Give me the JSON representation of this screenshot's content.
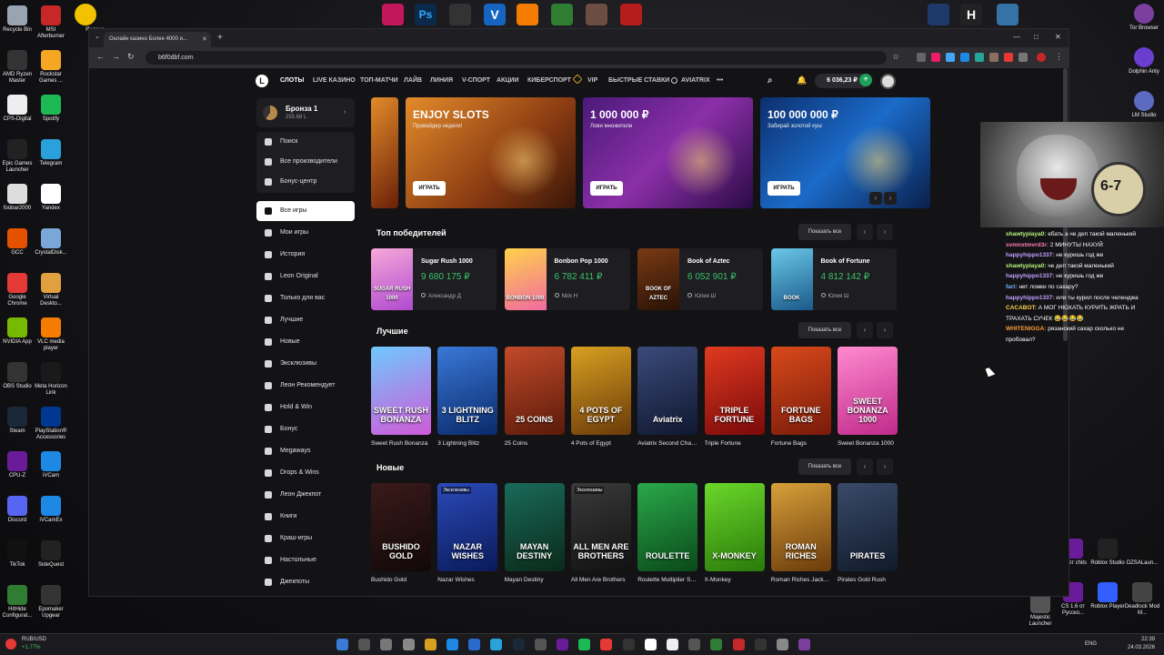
{
  "desktop": {
    "left_icons": [
      {
        "label": "Recycle Bin",
        "color": "#9aa4b1"
      },
      {
        "label": "MSI Afterburner",
        "color": "#c62828"
      },
      {
        "label": "AMD Ryzen Master",
        "color": "#333"
      },
      {
        "label": "Rockstar Games ...",
        "color": "#f5a623"
      },
      {
        "label": "CPS-Digital",
        "color": "#eee"
      },
      {
        "label": "Spotify",
        "color": "#1db954"
      },
      {
        "label": "Epic Games Launcher",
        "color": "#222"
      },
      {
        "label": "Telegram",
        "color": "#2aa1da"
      },
      {
        "label": "foobar2000",
        "color": "#ddd"
      },
      {
        "label": "Yandex",
        "color": "#fff"
      },
      {
        "label": "GCC",
        "color": "#e65100"
      },
      {
        "label": "CrystalDisk...",
        "color": "#7aa7d8"
      },
      {
        "label": "Google Chrome",
        "color": "#e53935"
      },
      {
        "label": "Virtual Deskto...",
        "color": "#e0a040"
      },
      {
        "label": "NVIDIA App",
        "color": "#76b900"
      },
      {
        "label": "VLC media player",
        "color": "#f57c00"
      },
      {
        "label": "OBS Studio",
        "color": "#333"
      },
      {
        "label": "Meta Horizon Link",
        "color": "#1a1a1a"
      },
      {
        "label": "Steam",
        "color": "#1b2838"
      },
      {
        "label": "PlayStation® Accessories",
        "color": "#003791"
      },
      {
        "label": "CPU-Z",
        "color": "#6a1b9a"
      },
      {
        "label": "iVCam",
        "color": "#1e88e5"
      },
      {
        "label": "Discord",
        "color": "#5865f2"
      },
      {
        "label": "iVCamEx",
        "color": "#1e88e5"
      },
      {
        "label": "TikTok",
        "color": "#111"
      },
      {
        "label": "SideQuest",
        "color": "#222"
      },
      {
        "label": "HitHide Configurat...",
        "color": "#2e7d32"
      },
      {
        "label": "Epomaker Upgear",
        "color": "#333"
      }
    ],
    "top_extra_label": "Яндекс",
    "right_icons": [
      {
        "label": "Tor Browser",
        "color": "#7b3fa0"
      },
      {
        "label": "Dolphin Anty",
        "color": "#6a3fd0"
      },
      {
        "label": "LM Studio",
        "color": "#5c6bc0"
      }
    ],
    "right_bottom_icons": [
      {
        "label": "Roblox Studio",
        "color": "#222"
      },
      {
        "label": "DZSALaun...",
        "color": "#111"
      },
      {
        "label": "Roblox Player",
        "color": "#335fff"
      },
      {
        "label": "Deadlock Mod M...",
        "color": "#444"
      },
      {
        "label": "Majestic Launcher",
        "color": "#555"
      },
      {
        "label": "CS 1.6 от Русско...",
        "color": "#6a1b9a"
      },
      {
        "label": "1.6 от chits",
        "color": "#6a1b9a"
      }
    ]
  },
  "browser": {
    "tab_title": "Онлайн казино Более 4000 и...",
    "url": "b6f0dbf.com",
    "win_controls": [
      "—",
      "□",
      "✕"
    ]
  },
  "site": {
    "logo": "L",
    "nav": [
      "СЛОТЫ",
      "LIVE КАЗИНО",
      "ТОП-МАТЧИ",
      "ЛАЙВ",
      "ЛИНИЯ",
      "V-СПОРТ",
      "АКЦИИ",
      "КИБЕРСПОРТ",
      "VIP",
      "БЫСТРЫЕ СТАВКИ",
      "AVIATRIX",
      "•••"
    ],
    "balance": "6 036,23 ₽",
    "profile": {
      "name": "Бронза 1",
      "points": "255.68 L"
    },
    "sidebar_top": [
      "Поиск",
      "Все производители",
      "Бонус-центр"
    ],
    "sidebar_items": [
      "Все игры",
      "Мои игры",
      "История",
      "Leon Original",
      "Только для вас",
      "Лучшие",
      "Новые",
      "Эксклюзивы",
      "Леон Рекомендует",
      "Hold & Win",
      "Бонус",
      "Megaways",
      "Drops & Wins",
      "Леон Джекпот",
      "Книги",
      "Краш-игры",
      "Настольные",
      "Джекпоты"
    ],
    "banners": [
      {
        "title": "ENJOY SLOTS",
        "subtitle": "Провайдер недели!",
        "button": "ИГРАТЬ",
        "bg": "linear-gradient(135deg,#e38b2a,#8a3b12 60%,#3a1608)"
      },
      {
        "title": "1 000 000 ₽",
        "subtitle": "Лови множители",
        "button": "ИГРАТЬ",
        "bg": "linear-gradient(135deg,#4a1a7a,#8b2fa8 50%,#2a0b45)"
      },
      {
        "title": "100 000 000 ₽",
        "subtitle": "Забирай золотой куш",
        "button": "ИГРАТЬ",
        "bg": "linear-gradient(135deg,#0d2f6e,#1b6bc9 50%,#0a1f4a)"
      }
    ],
    "sections": {
      "winners_title": "Топ победителей",
      "best_title": "Лучшие",
      "new_title": "Новые",
      "show_all": "Показать все"
    },
    "winners": [
      {
        "game": "Sugar Rush 1000",
        "amount": "9 680 175 ₽",
        "user": "Александр Д",
        "thumb": "linear-gradient(160deg,#f7a8d8,#b04ad0)",
        "art": "SUGAR RUSH 1000"
      },
      {
        "game": "Bonbon Pop 1000",
        "amount": "6 782 411 ₽",
        "user": "Nick H",
        "thumb": "linear-gradient(160deg,#ffd24a,#f06aa0)",
        "art": "BONBON 1000"
      },
      {
        "game": "Book of Aztec",
        "amount": "6 052 901 ₽",
        "user": "Юлия Ш",
        "thumb": "linear-gradient(160deg,#7a3a14,#2a1206)",
        "art": "BOOK OF AZTEC"
      },
      {
        "game": "Book of Fortune",
        "amount": "4 812 142 ₽",
        "user": "Юлия Ш",
        "thumb": "linear-gradient(160deg,#6ac8e8,#1a5a8a)",
        "art": "BOOK"
      }
    ],
    "best_games": [
      {
        "name": "Sweet Rush Bonanza",
        "bg": "linear-gradient(160deg,#6fc8ff,#d05ad8)",
        "art": "SWEET RUSH BONANZA"
      },
      {
        "name": "3 Lightning Blitz",
        "bg": "linear-gradient(160deg,#3a78d8,#0a2a6a)",
        "art": "3 LIGHTNING BLITZ"
      },
      {
        "name": "25 Coins",
        "bg": "linear-gradient(160deg,#c24a2a,#5a1a0a)",
        "art": "25 COINS"
      },
      {
        "name": "4 Pots of Egypt",
        "bg": "linear-gradient(160deg,#d8a020,#6a3a0a)",
        "art": "4 POTS OF EGYPT"
      },
      {
        "name": "Aviatrix Second Chance",
        "bg": "linear-gradient(160deg,#3a4a7a,#101830)",
        "art": "Aviatrix"
      },
      {
        "name": "Triple Fortune",
        "bg": "linear-gradient(160deg,#e03a20,#7a0a0a)",
        "art": "TRIPLE FORTUNE"
      },
      {
        "name": "Fortune Bags",
        "bg": "linear-gradient(160deg,#d84a1a,#7a1a0a)",
        "art": "FORTUNE BAGS"
      },
      {
        "name": "Sweet Bonanza 1000",
        "bg": "linear-gradient(160deg,#ff8ad0,#c02a8a)",
        "art": "SWEET BONANZA 1000"
      }
    ],
    "new_games": [
      {
        "name": "Bushido Gold",
        "bg": "linear-gradient(160deg,#3a1a1a,#120808)",
        "art": "BUSHIDO GOLD",
        "tag": ""
      },
      {
        "name": "Nazar Wishes",
        "bg": "linear-gradient(160deg,#2a4ab8,#0a1a5a)",
        "art": "NAZAR WISHES",
        "tag": "Эксклюзивы"
      },
      {
        "name": "Mayan Destiny",
        "bg": "linear-gradient(160deg,#1a6a5a,#0a2a1a)",
        "art": "MAYAN DESTINY",
        "tag": ""
      },
      {
        "name": "All Men Are Brothers",
        "bg": "linear-gradient(160deg,#3a3a3a,#111)",
        "art": "ALL MEN ARE BROTHERS",
        "tag": "Эксклюзивы"
      },
      {
        "name": "Roulette Multiplier Spin",
        "bg": "linear-gradient(160deg,#2aa84a,#0a4a1a)",
        "art": "ROULETTE",
        "tag": ""
      },
      {
        "name": "X-Monkey",
        "bg": "linear-gradient(160deg,#6ad82a,#2a7a0a)",
        "art": "X-MONKEY",
        "tag": ""
      },
      {
        "name": "Roman Riches Jackpot",
        "bg": "linear-gradient(160deg,#d8a03a,#6a3a0a)",
        "art": "ROMAN RICHES",
        "tag": ""
      },
      {
        "name": "Pirates Gold Rush",
        "bg": "linear-gradient(160deg,#3a4a6a,#101a2a)",
        "art": "PIRATES",
        "tag": ""
      }
    ]
  },
  "chat": {
    "cam_text": "6-7",
    "messages": [
      {
        "user": "shawtyplaya0:",
        "color": "#b6f57a",
        "text": " ебать а че деп такой маленький"
      },
      {
        "user": "svmnxtmvrd3r:",
        "color": "#ff7ab0",
        "text": " 2 МИНУТЫ НАХУЙ"
      },
      {
        "user": "happyhippo1337:",
        "color": "#c0a0ff",
        "text": " не куришь год же"
      },
      {
        "user": "shawtyplaya0:",
        "color": "#b6f57a",
        "text": " че деп такой маленький"
      },
      {
        "user": "happyhippo1337:",
        "color": "#c0a0ff",
        "text": " не куришь год же"
      },
      {
        "user": "fart:",
        "color": "#7ab0ff",
        "text": " нет ломки по сахару?"
      },
      {
        "user": "happyhippo1337:",
        "color": "#c0a0ff",
        "text": " или ты курил после челенджа"
      },
      {
        "user": "CACABOT:",
        "color": "#ffd24a",
        "text": " А МОГ НЮХАТЬ КУРИТЬ ЖРАТЬ И"
      },
      {
        "user": "",
        "color": "#fff",
        "text": "ТРАХАТЬ СУЧЕК 😂😂😂😂"
      },
      {
        "user": "WHITENIGGA:",
        "color": "#ff9a3a",
        "text": " рязанский сахар сколько не"
      },
      {
        "user": "",
        "color": "#fff",
        "text": "пробовал?"
      }
    ]
  },
  "taskbar": {
    "ticker": "RUB/USD",
    "ticker_change": "+1.77%",
    "lang": "ENG",
    "time": "22:39",
    "date": "24.03.2026"
  }
}
